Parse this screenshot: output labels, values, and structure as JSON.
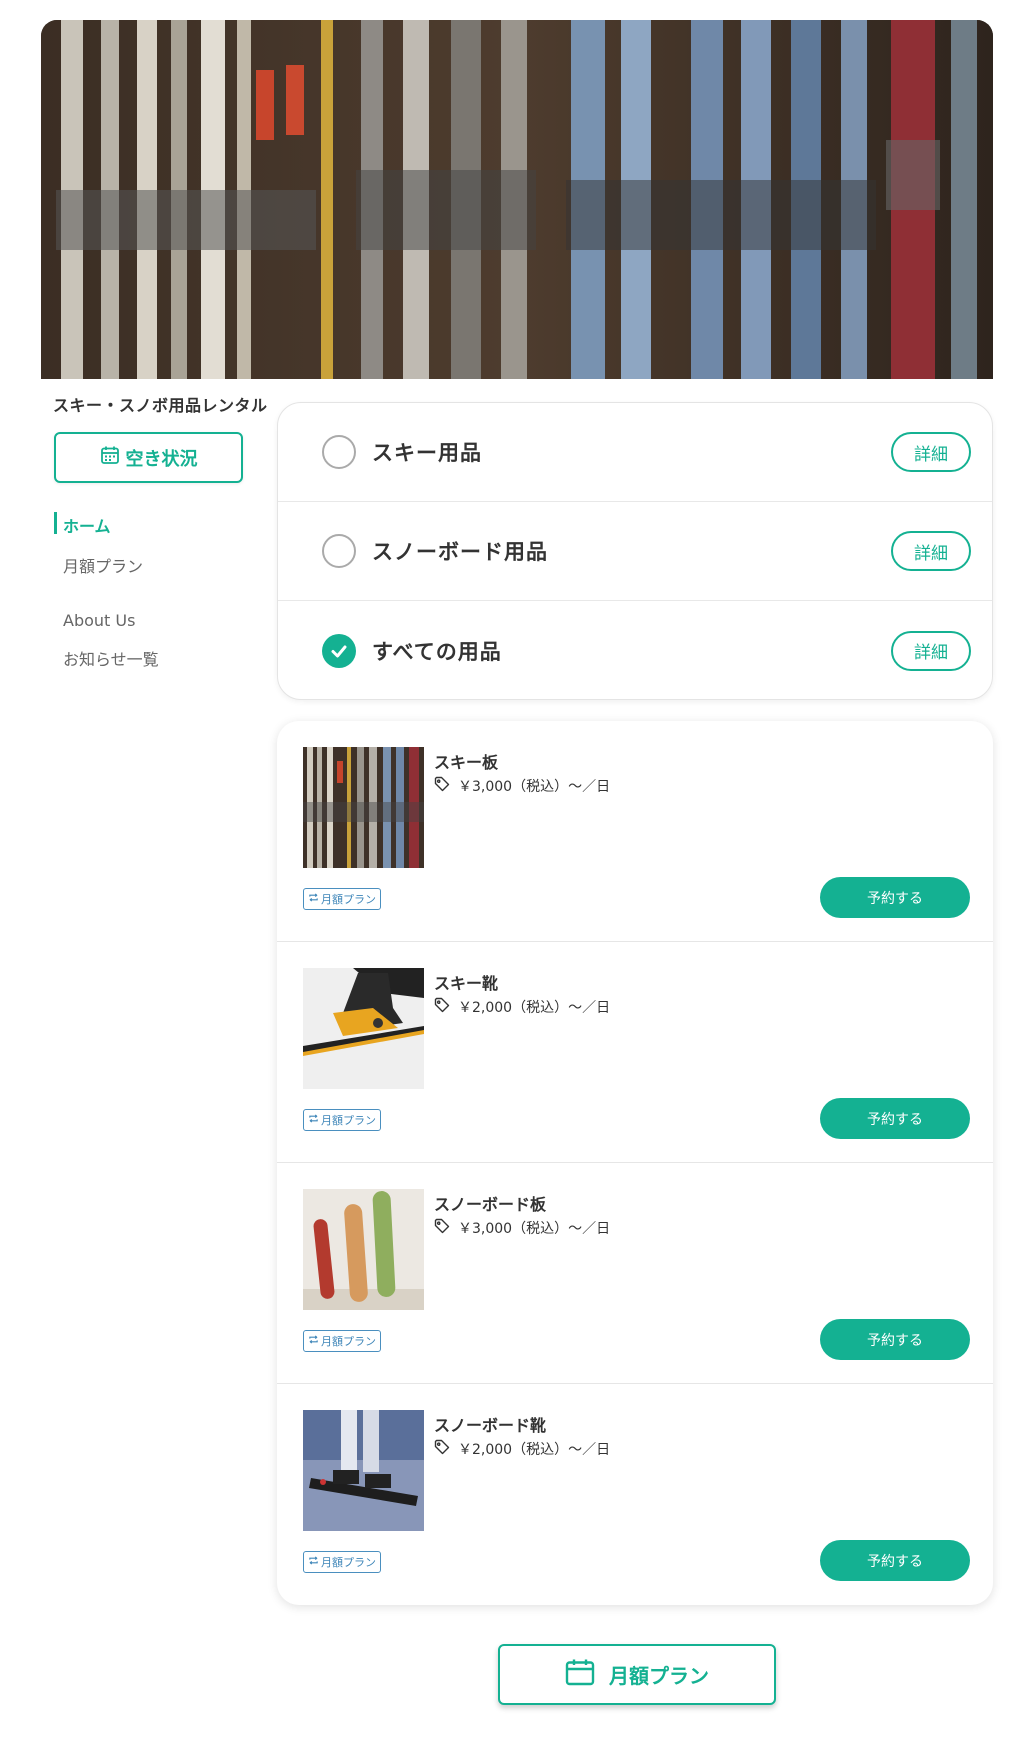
{
  "hero": {
    "image": "ski-rack-photo"
  },
  "sidebar": {
    "shop_title": "スキー・スノボ用品レンタル",
    "availability_button": "空き状況",
    "nav": [
      {
        "label": "ホーム",
        "active": true
      },
      {
        "label": "月額プラン",
        "active": false
      },
      {
        "label": "About Us",
        "active": false
      },
      {
        "label": "お知らせ一覧",
        "active": false
      }
    ]
  },
  "categories": [
    {
      "label": "スキー用品",
      "checked": false,
      "detail": "詳細"
    },
    {
      "label": "スノーボード用品",
      "checked": false,
      "detail": "詳細"
    },
    {
      "label": "すべての用品",
      "checked": true,
      "detail": "詳細"
    }
  ],
  "products": [
    {
      "name": "スキー板",
      "price": "￥3,000（税込）〜／日",
      "badge": "月額プラン",
      "reserve": "予約する",
      "image": "ski-rack-thumb"
    },
    {
      "name": "スキー靴",
      "price": "￥2,000（税込）〜／日",
      "badge": "月額プラン",
      "reserve": "予約する",
      "image": "ski-boot-thumb"
    },
    {
      "name": "スノーボード板",
      "price": "￥3,000（税込）〜／日",
      "badge": "月額プラン",
      "reserve": "予約する",
      "image": "snowboard-thumb"
    },
    {
      "name": "スノーボード靴",
      "price": "￥2,000（税込）〜／日",
      "badge": "月額プラン",
      "reserve": "予約する",
      "image": "snowboard-boot-thumb"
    }
  ],
  "bottom_button": "月額プラン",
  "colors": {
    "accent": "#14b192",
    "badge": "#3d85b8"
  }
}
